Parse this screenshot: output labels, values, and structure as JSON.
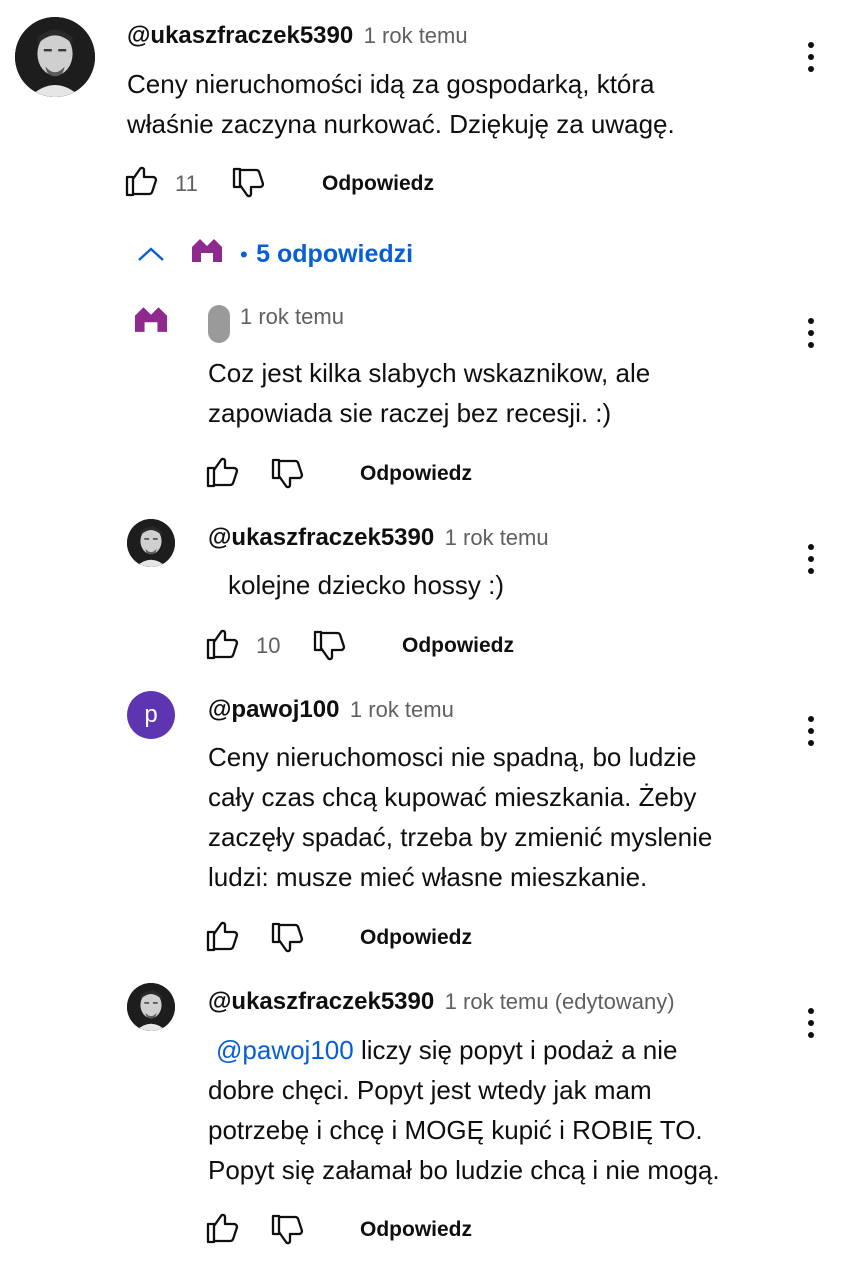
{
  "thread": {
    "top_comment": {
      "handle": "@ukaszfraczek5390",
      "time": "1 rok temu",
      "text_line1": "Ceny nieruchomości idą za gospodarką, która",
      "text_line2": "właśnie zaczyna nurkować. Dziękuję za uwagę.",
      "likes": "11",
      "reply_label": "Odpowiedz"
    },
    "replies_toggle": {
      "bullet": "•",
      "label": "5 odpowiedzi"
    },
    "replies": [
      {
        "handle": "",
        "time": "1 rok temu",
        "text_line1": "Coz jest kilka slabych wskaznikow, ale",
        "text_line2": "zapowiada sie raczej bez recesji. :)",
        "likes": "",
        "reply_label": "Odpowiedz"
      },
      {
        "handle": "@ukaszfraczek5390",
        "time": "1 rok temu",
        "text_line1": "kolejne dziecko hossy :)",
        "likes": "10",
        "reply_label": "Odpowiedz"
      },
      {
        "handle": "@pawoj100",
        "avatar_letter": "p",
        "time": "1 rok temu",
        "text_line1": "Ceny nieruchomosci nie spadną, bo ludzie",
        "text_line2": "cały czas chcą kupować mieszkania. Żeby",
        "text_line3": "zaczęły spadać, trzeba by zmienić myslenie",
        "text_line4": "ludzi: musze mieć własne mieszkanie.",
        "likes": "",
        "reply_label": "Odpowiedz"
      },
      {
        "handle": "@ukaszfraczek5390",
        "time": "1 rok temu (edytowany)",
        "mention": "@pawoj100",
        "text_line1": " liczy się popyt i podaż a nie",
        "text_line2": "dobre chęci. Popyt jest wtedy jak mam",
        "text_line3": "potrzebę i chcę i MOGĘ kupić i ROBIĘ TO.",
        "text_line4": "Popyt się załamał bo ludzie chcą i nie mogą.",
        "likes": "",
        "reply_label": "Odpowiedz"
      }
    ]
  },
  "icons": {
    "like": "thumb-up-icon",
    "dislike": "thumb-down-icon",
    "more": "more-vert-icon",
    "collapse": "chevron-up-icon",
    "channel": "house-logo-icon"
  },
  "colors": {
    "link": "#065fd4",
    "channel_logo": "#8e2a8e",
    "letter_avatar": "#5e35b1",
    "muted": "#606060"
  }
}
